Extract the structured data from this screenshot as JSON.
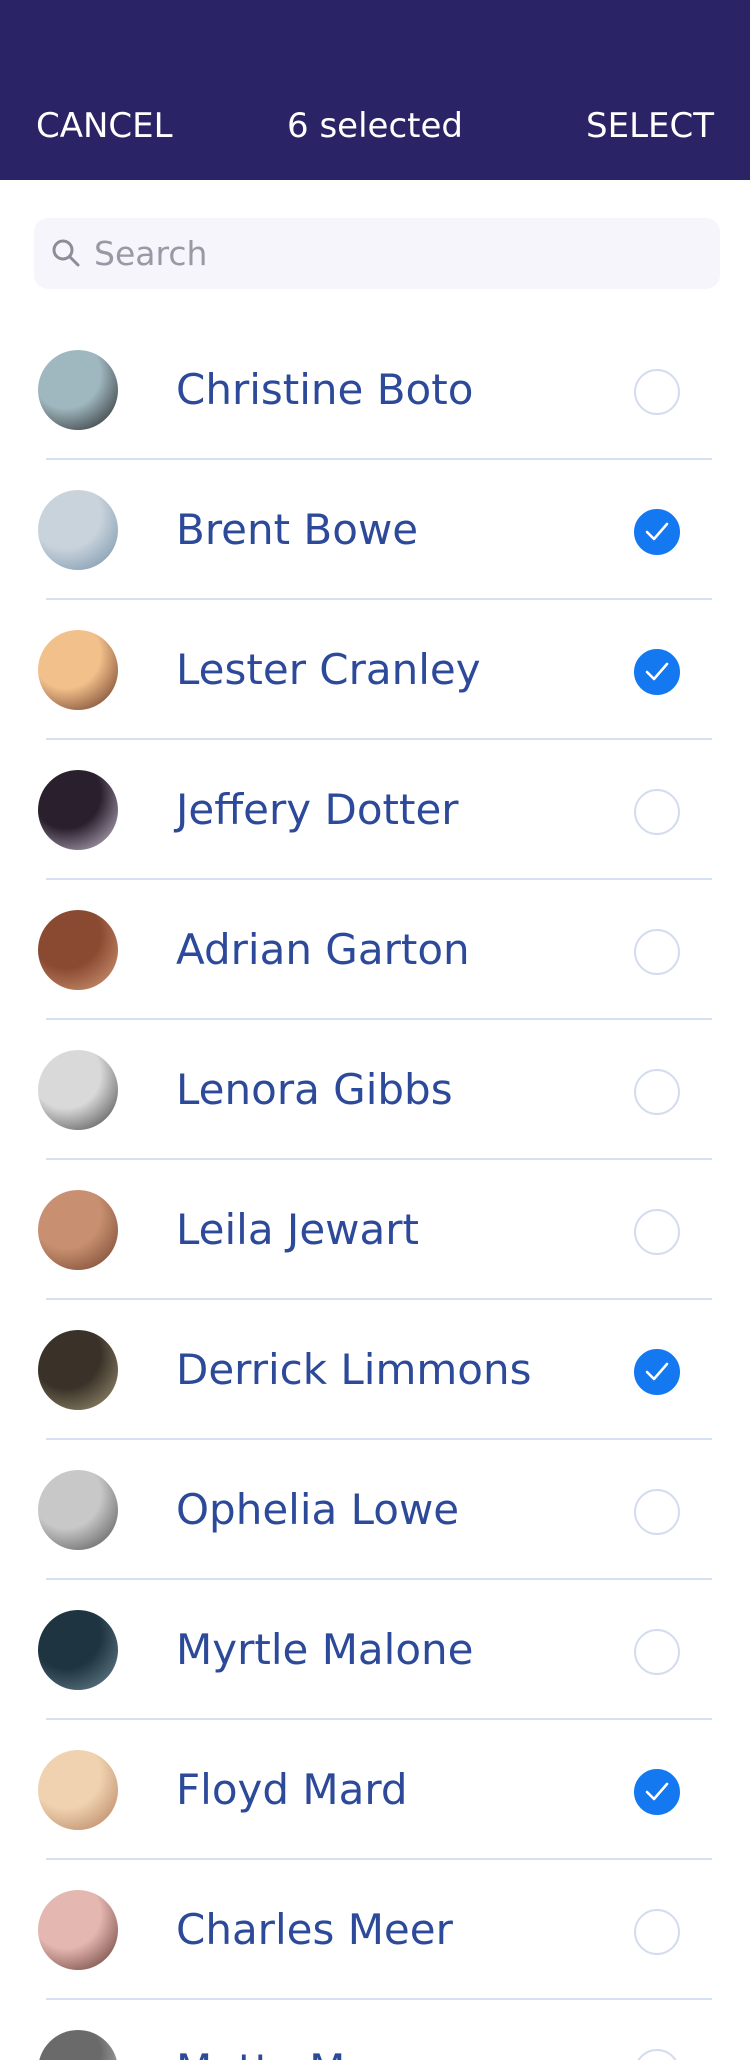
{
  "header": {
    "cancel_label": "CANCEL",
    "title": "6 selected",
    "select_label": "SELECT",
    "background": "#2a2366"
  },
  "search": {
    "placeholder": "Search",
    "value": ""
  },
  "accent_color": "#1478f0",
  "name_color": "#2d4a9a",
  "contacts": [
    {
      "name": "Christine Boto",
      "selected": false,
      "avatar_icon": "person-avatar"
    },
    {
      "name": "Brent Bowe",
      "selected": true,
      "avatar_icon": "person-avatar"
    },
    {
      "name": "Lester Cranley",
      "selected": true,
      "avatar_icon": "person-avatar"
    },
    {
      "name": "Jeffery Dotter",
      "selected": false,
      "avatar_icon": "person-avatar"
    },
    {
      "name": "Adrian Garton",
      "selected": false,
      "avatar_icon": "person-avatar"
    },
    {
      "name": "Lenora Gibbs",
      "selected": false,
      "avatar_icon": "person-avatar"
    },
    {
      "name": "Leila Jewart",
      "selected": false,
      "avatar_icon": "person-avatar"
    },
    {
      "name": "Derrick Limmons",
      "selected": true,
      "avatar_icon": "person-avatar"
    },
    {
      "name": "Ophelia Lowe",
      "selected": false,
      "avatar_icon": "person-avatar"
    },
    {
      "name": "Myrtle Malone",
      "selected": false,
      "avatar_icon": "person-avatar"
    },
    {
      "name": "Floyd Mard",
      "selected": true,
      "avatar_icon": "person-avatar"
    },
    {
      "name": "Charles Meer",
      "selected": false,
      "avatar_icon": "person-avatar"
    },
    {
      "name": "Matty Moore",
      "selected": false,
      "avatar_icon": "person-avatar"
    }
  ]
}
